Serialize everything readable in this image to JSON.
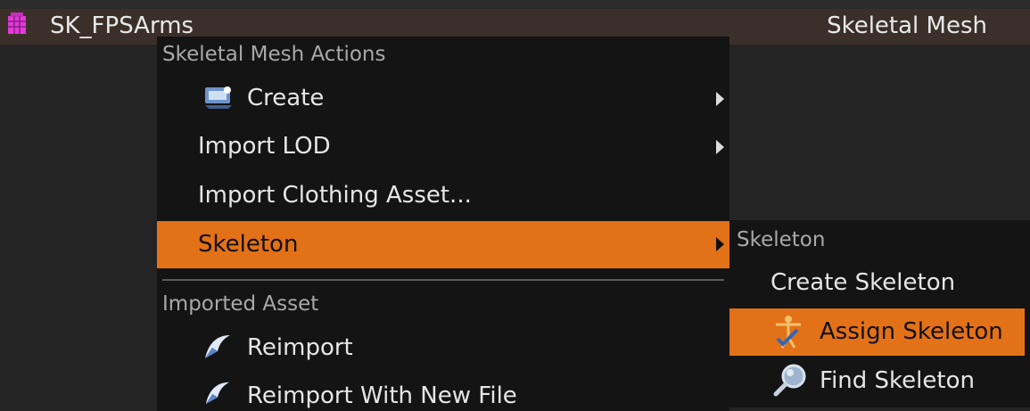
{
  "colors": {
    "highlight": "#e37118",
    "menu_bg": "#141414",
    "selected_row": "#3b3029"
  },
  "asset_row": {
    "name": "SK_FPSArms",
    "type": "Skeletal Mesh",
    "icon": "skeletal-mesh-icon"
  },
  "menu": {
    "section1_header": "Skeletal Mesh Actions",
    "items": [
      {
        "label": "Create",
        "icon": "create-icon",
        "submenu": true
      },
      {
        "label": "Import LOD",
        "submenu": true
      },
      {
        "label": "Import Clothing Asset..."
      },
      {
        "label": "Skeleton",
        "submenu": true,
        "highlighted": true
      }
    ],
    "section2_header": "Imported Asset",
    "items2": [
      {
        "label": "Reimport",
        "icon": "reimport-icon"
      },
      {
        "label": "Reimport With New File",
        "icon": "reimport-icon"
      }
    ]
  },
  "submenu": {
    "header": "Skeleton",
    "items": [
      {
        "label": "Create Skeleton"
      },
      {
        "label": "Assign Skeleton",
        "icon": "assign-skeleton-icon",
        "highlighted": true
      },
      {
        "label": "Find Skeleton",
        "icon": "magnifier-icon"
      }
    ]
  }
}
